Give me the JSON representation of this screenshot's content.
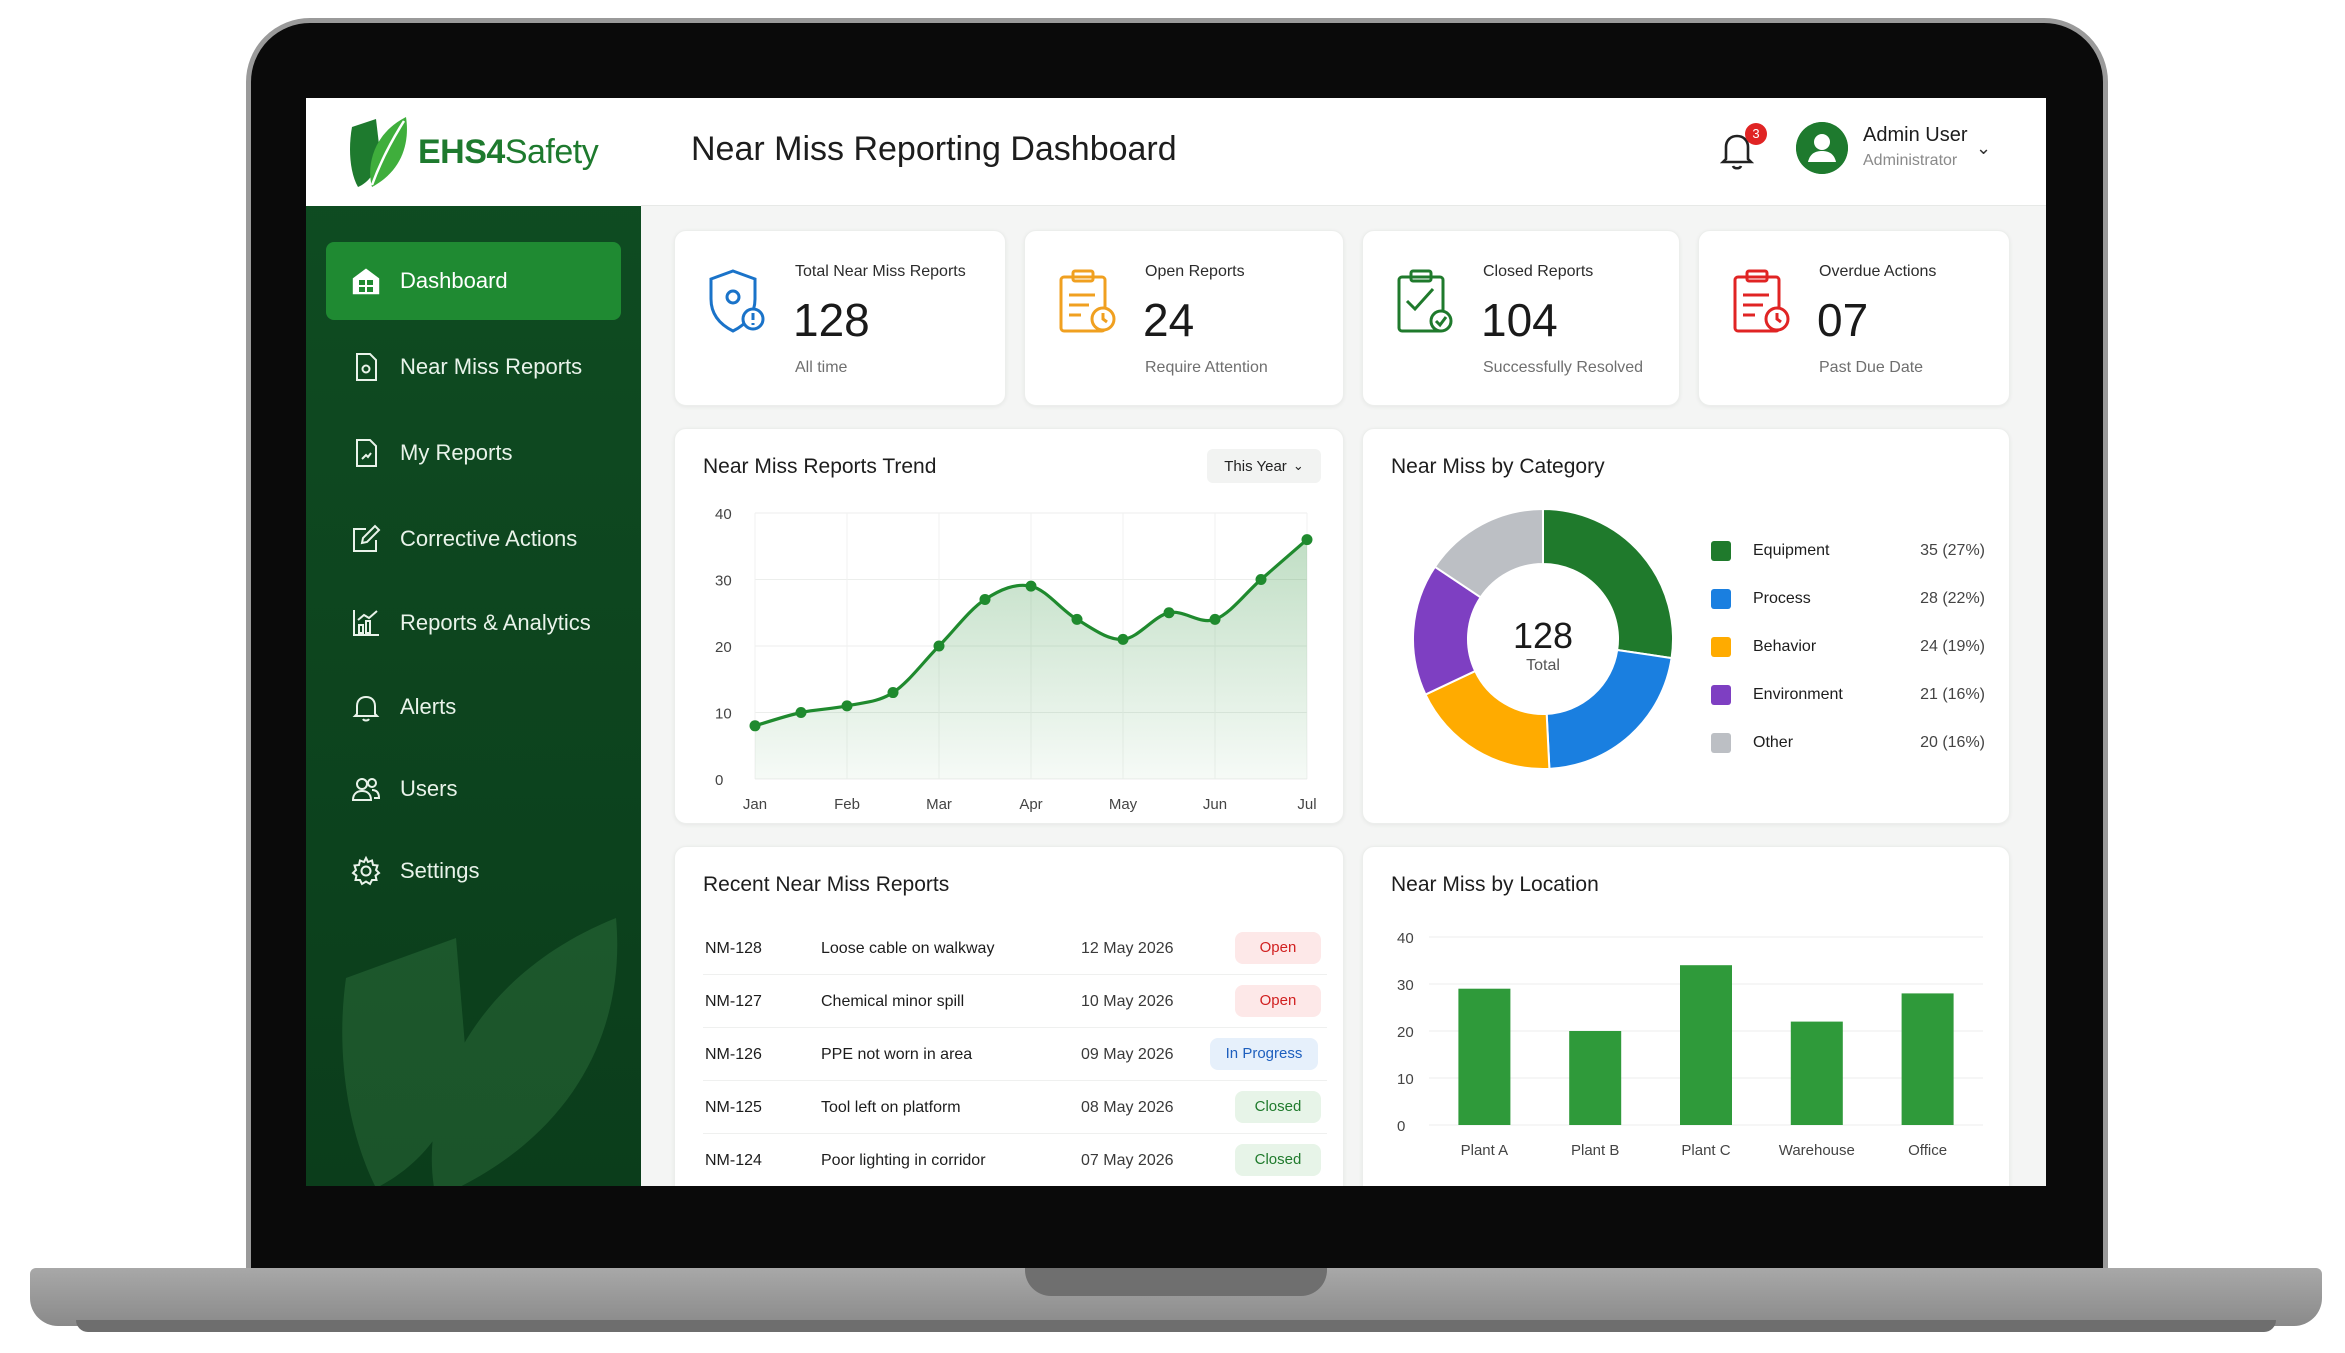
{
  "app": {
    "brand_name_bold": "EHS4",
    "brand_name_rest": "Safety"
  },
  "header": {
    "title": "Near Miss Reporting Dashboard",
    "notification_count": "3",
    "user_name": "Admin User",
    "user_role": "Administrator"
  },
  "sidebar": {
    "items": [
      {
        "label": "Dashboard",
        "icon": "dashboard-icon",
        "active": true
      },
      {
        "label": "Near Miss Reports",
        "icon": "document-icon",
        "active": false
      },
      {
        "label": "My Reports",
        "icon": "my-reports-icon",
        "active": false
      },
      {
        "label": "Corrective Actions",
        "icon": "edit-icon",
        "active": false
      },
      {
        "label": "Reports & Analytics",
        "icon": "analytics-icon",
        "active": false
      },
      {
        "label": "Alerts",
        "icon": "bell-icon",
        "active": false
      },
      {
        "label": "Users",
        "icon": "users-icon",
        "active": false
      },
      {
        "label": "Settings",
        "icon": "gear-icon",
        "active": false
      }
    ]
  },
  "kpis": [
    {
      "label": "Total Near Miss Reports",
      "value": "128",
      "sub": "All time",
      "color": "#1a73c9",
      "icon": "shield-alert-icon"
    },
    {
      "label": "Open Reports",
      "value": "24",
      "sub": "Require Attention",
      "color": "#f0a020",
      "icon": "clipboard-clock-icon"
    },
    {
      "label": "Closed Reports",
      "value": "104",
      "sub": "Successfully Resolved",
      "color": "#1f7a2c",
      "icon": "clipboard-check-icon"
    },
    {
      "label": "Overdue Actions",
      "value": "07",
      "sub": "Past Due Date",
      "color": "#e02424",
      "icon": "clipboard-overdue-icon"
    }
  ],
  "trend": {
    "title": "Near Miss Reports Trend",
    "period": "This Year"
  },
  "category": {
    "title": "Near Miss by Category",
    "total_value": "128",
    "total_label": "Total"
  },
  "recent": {
    "title": "Recent Near Miss Reports",
    "rows": [
      {
        "id": "NM-128",
        "desc": "Loose cable on walkway",
        "date": "12 May 2026",
        "status": "Open",
        "kind": "open"
      },
      {
        "id": "NM-127",
        "desc": "Chemical minor spill",
        "date": "10 May 2026",
        "status": "Open",
        "kind": "open"
      },
      {
        "id": "NM-126",
        "desc": "PPE not worn in area",
        "date": "09 May 2026",
        "status": "In Progress",
        "kind": "progress"
      },
      {
        "id": "NM-125",
        "desc": "Tool left on platform",
        "date": "08 May 2026",
        "status": "Closed",
        "kind": "closed"
      },
      {
        "id": "NM-124",
        "desc": "Poor lighting in corridor",
        "date": "07 May 2026",
        "status": "Closed",
        "kind": "closed"
      }
    ]
  },
  "location": {
    "title": "Near Miss by Location"
  },
  "chart_data": [
    {
      "type": "area",
      "title": "Near Miss Reports Trend",
      "x_tick_labels": [
        "Jan",
        "Feb",
        "Mar",
        "Apr",
        "May",
        "Jun",
        "Jul"
      ],
      "y_ticks": [
        0,
        10,
        20,
        30,
        40
      ],
      "ylim": [
        0,
        40
      ],
      "x": [
        0,
        0.5,
        1,
        1.5,
        2,
        2.5,
        3,
        3.5,
        4,
        4.5,
        5,
        5.5,
        6
      ],
      "values": [
        8,
        10,
        11,
        13,
        20,
        27,
        29,
        24,
        21,
        25,
        24,
        30,
        36
      ],
      "grid": true,
      "color": "#1f8a2e"
    },
    {
      "type": "pie",
      "title": "Near Miss by Category",
      "donut": true,
      "categories": [
        "Equipment",
        "Process",
        "Behavior",
        "Environment",
        "Other"
      ],
      "values": [
        35,
        28,
        24,
        21,
        20
      ],
      "labels": [
        "35 (27%)",
        "28 (22%)",
        "24 (19%)",
        "21 (16%)",
        "20 (16%)"
      ],
      "colors": [
        "#1f7a2c",
        "#1a7fe0",
        "#ffab00",
        "#7e3fc2",
        "#bcbfc4"
      ],
      "legend": "right"
    },
    {
      "type": "bar",
      "title": "Near Miss by Location",
      "categories": [
        "Plant A",
        "Plant B",
        "Plant C",
        "Warehouse",
        "Office"
      ],
      "values": [
        29,
        20,
        34,
        22,
        28
      ],
      "y_ticks": [
        0,
        10,
        20,
        30,
        40
      ],
      "ylim": [
        0,
        40
      ],
      "color": "#2f9a3a"
    }
  ]
}
